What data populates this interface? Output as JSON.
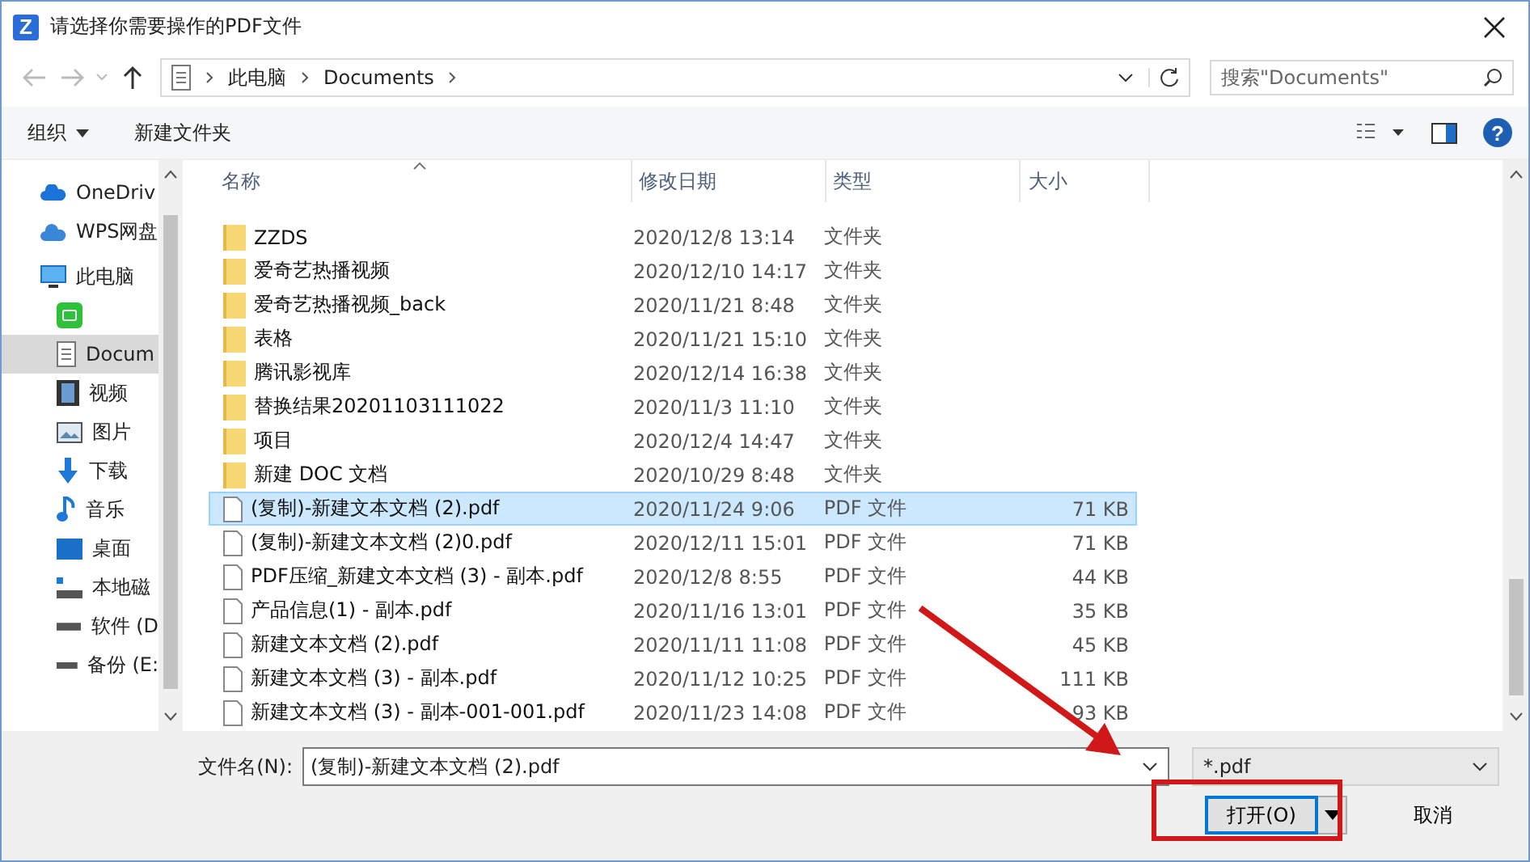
{
  "window": {
    "title": "请选择你需要操作的PDF文件",
    "logo": "Z"
  },
  "address": {
    "crumbs": [
      "此电脑",
      "Documents"
    ],
    "search_placeholder": "搜索\"Documents\""
  },
  "toolbar": {
    "organize": "组织",
    "new_folder": "新建文件夹",
    "help": "?"
  },
  "sidebar": {
    "items": [
      {
        "label": "OneDriv",
        "kind": "cloud",
        "selected": false
      },
      {
        "label": "WPS网盘",
        "kind": "cloud2",
        "selected": false
      },
      {
        "label": "此电脑",
        "kind": "pc",
        "selected": false
      },
      {
        "kind": "app",
        "selected": false
      },
      {
        "label": "Docum",
        "kind": "doc",
        "selected": true
      },
      {
        "label": "视频",
        "kind": "video",
        "selected": false
      },
      {
        "label": "图片",
        "kind": "picture",
        "selected": false
      },
      {
        "label": "下载",
        "kind": "download",
        "selected": false
      },
      {
        "label": "音乐",
        "kind": "music",
        "selected": false
      },
      {
        "label": "桌面",
        "kind": "desktop",
        "selected": false
      },
      {
        "label": "本地磁",
        "kind": "disk",
        "selected": false
      },
      {
        "label": "软件 (D",
        "kind": "drive",
        "selected": false
      },
      {
        "label": "备份 (E:",
        "kind": "drive",
        "selected": false
      }
    ]
  },
  "table": {
    "columns": [
      "名称",
      "修改日期",
      "类型",
      "大小"
    ],
    "rows": [
      {
        "name": "ZZDS",
        "date": "2020/12/8 13:14",
        "type": "文件夹",
        "size": "",
        "kind": "folder",
        "selected": false
      },
      {
        "name": "爱奇艺热播视频",
        "date": "2020/12/10 14:17",
        "type": "文件夹",
        "size": "",
        "kind": "folder",
        "selected": false
      },
      {
        "name": "爱奇艺热播视频_back",
        "date": "2020/11/21 8:48",
        "type": "文件夹",
        "size": "",
        "kind": "folder",
        "selected": false
      },
      {
        "name": "表格",
        "date": "2020/11/21 15:10",
        "type": "文件夹",
        "size": "",
        "kind": "folder",
        "selected": false
      },
      {
        "name": "腾讯影视库",
        "date": "2020/12/14 16:38",
        "type": "文件夹",
        "size": "",
        "kind": "folder",
        "selected": false
      },
      {
        "name": "替换结果20201103111022",
        "date": "2020/11/3 11:10",
        "type": "文件夹",
        "size": "",
        "kind": "folder",
        "selected": false
      },
      {
        "name": "项目",
        "date": "2020/12/4 14:47",
        "type": "文件夹",
        "size": "",
        "kind": "folder",
        "selected": false
      },
      {
        "name": "新建 DOC 文档",
        "date": "2020/10/29 8:48",
        "type": "文件夹",
        "size": "",
        "kind": "folder",
        "selected": false
      },
      {
        "name": "(复制)-新建文本文档 (2).pdf",
        "date": "2020/11/24 9:06",
        "type": "PDF 文件",
        "size": "71 KB",
        "kind": "file",
        "selected": true
      },
      {
        "name": "(复制)-新建文本文档 (2)0.pdf",
        "date": "2020/12/11 15:01",
        "type": "PDF 文件",
        "size": "71 KB",
        "kind": "file",
        "selected": false
      },
      {
        "name": "PDF压缩_新建文本文档 (3) - 副本.pdf",
        "date": "2020/12/8 8:55",
        "type": "PDF 文件",
        "size": "44 KB",
        "kind": "file",
        "selected": false
      },
      {
        "name": "产品信息(1) - 副本.pdf",
        "date": "2020/11/16 13:01",
        "type": "PDF 文件",
        "size": "35 KB",
        "kind": "file",
        "selected": false
      },
      {
        "name": "新建文本文档 (2).pdf",
        "date": "2020/11/11 11:08",
        "type": "PDF 文件",
        "size": "45 KB",
        "kind": "file",
        "selected": false
      },
      {
        "name": "新建文本文档 (3) - 副本.pdf",
        "date": "2020/11/12 10:25",
        "type": "PDF 文件",
        "size": "111 KB",
        "kind": "file",
        "selected": false
      },
      {
        "name": "新建文本文档 (3) - 副本-001-001.pdf",
        "date": "2020/11/23 14:08",
        "type": "PDF 文件",
        "size": "93 KB",
        "kind": "file",
        "selected": false
      }
    ]
  },
  "footer": {
    "filename_label": "文件名(N):",
    "filename": "(复制)-新建文本文档 (2).pdf",
    "filter": "*.pdf",
    "open": "打开(O)",
    "cancel": "取消"
  }
}
